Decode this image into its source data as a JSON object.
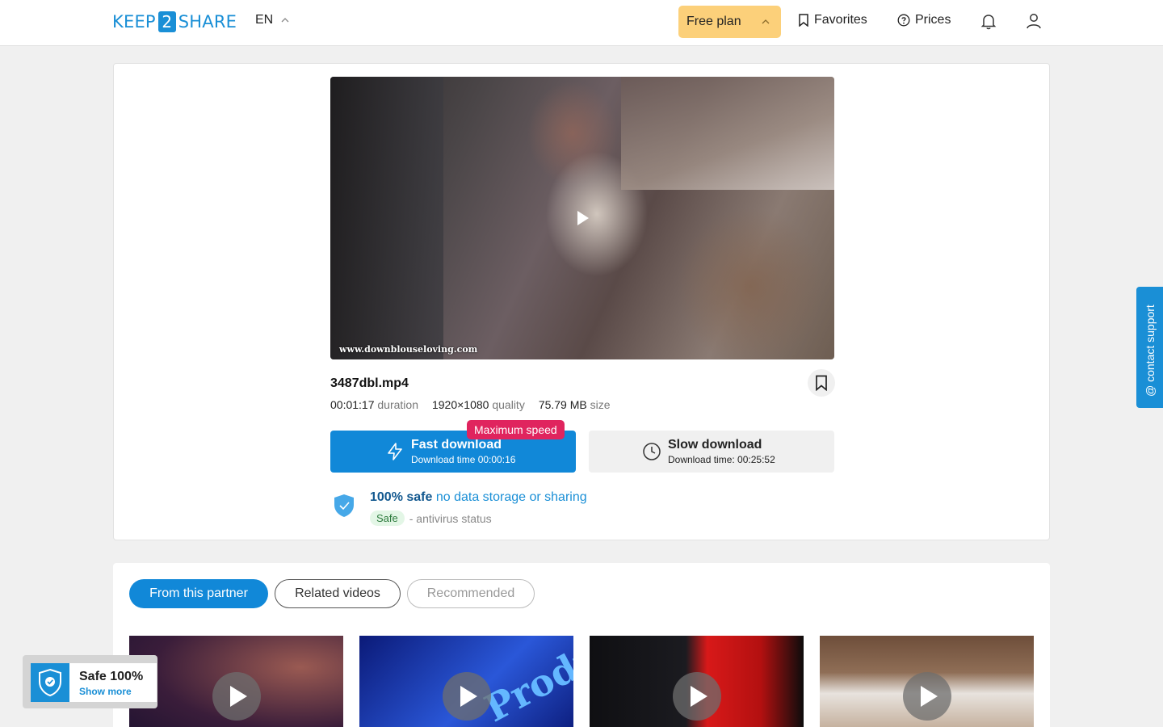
{
  "header": {
    "logo": {
      "left": "KEEP",
      "mid": "2",
      "right": "SHARE"
    },
    "lang": "EN",
    "plan": "Free plan",
    "nav": {
      "favorites": "Favorites",
      "prices": "Prices"
    }
  },
  "file": {
    "name": "3487dbl.mp4",
    "duration": "00:01:17",
    "duration_label": "duration",
    "quality": "1920×1080",
    "quality_label": "quality",
    "size": "75.79 MB",
    "size_label": "size",
    "watermark": "www.downblouseloving.com"
  },
  "download": {
    "fast_label": "Fast download",
    "fast_time": "Download time 00:00:16",
    "badge": "Maximum speed",
    "slow_label": "Slow download",
    "slow_time": "Download time: 00:25:52"
  },
  "safety": {
    "headline": "100% safe",
    "subline": "no data storage or sharing",
    "status_pill": "Safe",
    "status_text": "- antivirus status"
  },
  "support": {
    "label": "@ contact support"
  },
  "tabs": [
    "From this partner",
    "Related videos",
    "Recommended"
  ],
  "thumbs": [
    {
      "text": ""
    },
    {
      "text": "Produ"
    },
    {
      "text": ""
    },
    {
      "text": ""
    }
  ],
  "safe_popup": {
    "title": "Safe 100%",
    "link": "Show more"
  },
  "colors": {
    "brand": "#1a8fd6",
    "fast_button": "#1188d8",
    "plan_bg": "#fcd07a",
    "badge": "#e0245e"
  }
}
